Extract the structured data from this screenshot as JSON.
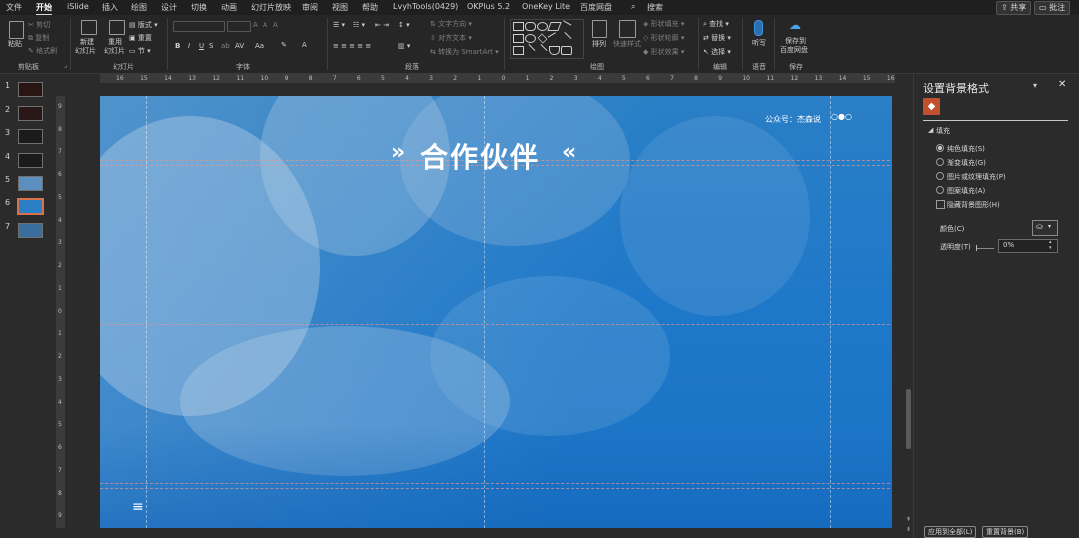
{
  "ribbon_tabs": [
    "文件",
    "开始",
    "iSlide",
    "插入",
    "绘图",
    "设计",
    "切换",
    "动画",
    "幻灯片放映",
    "审阅",
    "视图",
    "帮助",
    "LvyhTools(0429)",
    "OKPlus 5.2",
    "OneKey Lite",
    "百度网盘"
  ],
  "active_tab": "开始",
  "search_label": "搜索",
  "share_label": "共享",
  "comment_label": "批注",
  "clipboard": {
    "paste": "粘贴",
    "cut": "剪切",
    "copy": "复制",
    "format_painter": "格式刷",
    "group": "剪贴板"
  },
  "slides_group": {
    "new_slide_1": "新建",
    "new_slide_2": "幻灯片",
    "reuse_1": "重用",
    "reuse_2": "幻灯片",
    "layout": "版式",
    "reset": "重置",
    "section": "节",
    "group": "幻灯片"
  },
  "font_group": {
    "group": "字体",
    "bold": "B",
    "italic": "I",
    "underline": "U",
    "strike": "S",
    "spacing": "AV",
    "case": "Aa",
    "grow": "A",
    "shrink": "A",
    "clear": "A"
  },
  "paragraph_group": {
    "text_direction": "文字方向",
    "align_text": "对齐文本",
    "smartart": "转换为 SmartArt",
    "group": "段落"
  },
  "drawing_group": {
    "arrange": "排列",
    "quick_styles": "快速样式",
    "fill": "形状填充",
    "outline": "形状轮廓",
    "effects": "形状效果",
    "group": "绘图"
  },
  "editing_group": {
    "find": "查找",
    "replace": "替换",
    "select": "选择",
    "group": "编辑"
  },
  "voice_group": {
    "dictate": "听写",
    "group": "语音"
  },
  "save_group": {
    "save_1": "保存到",
    "save_2": "百度网盘",
    "group": "保存"
  },
  "thumbnails": [
    {
      "num": "1"
    },
    {
      "num": "2"
    },
    {
      "num": "3"
    },
    {
      "num": "4"
    },
    {
      "num": "5"
    },
    {
      "num": "6",
      "active": true
    },
    {
      "num": "7"
    }
  ],
  "ruler_h": [
    "16",
    "15",
    "14",
    "13",
    "12",
    "11",
    "10",
    "9",
    "8",
    "7",
    "6",
    "5",
    "4",
    "3",
    "2",
    "1",
    "0",
    "1",
    "2",
    "3",
    "4",
    "5",
    "6",
    "7",
    "8",
    "9",
    "10",
    "11",
    "12",
    "13",
    "14",
    "15",
    "16"
  ],
  "ruler_v": [
    "9",
    "8",
    "7",
    "6",
    "5",
    "4",
    "3",
    "2",
    "1",
    "0",
    "1",
    "2",
    "3",
    "4",
    "5",
    "6",
    "7",
    "8",
    "9"
  ],
  "slide": {
    "account": "公众号：杰森说",
    "title": "合作伙伴",
    "left_mark": "»",
    "right_mark": "«",
    "menu_glyph": "≡",
    "dots": [
      "○",
      "●",
      "○"
    ]
  },
  "pane": {
    "title": "设置背景格式",
    "section": "填充",
    "options": [
      {
        "label": "纯色填充(S)",
        "selected": true
      },
      {
        "label": "渐变填充(G)",
        "selected": false
      },
      {
        "label": "图片或纹理填充(P)",
        "selected": false
      },
      {
        "label": "图案填充(A)",
        "selected": false
      }
    ],
    "hide_bg": "隐藏背景图形(H)",
    "color_label": "颜色(C)",
    "transparency_label": "透明度(T)",
    "transparency_value": "0%",
    "apply_all": "应用到全部(L)",
    "reset_bg": "重置背景(B)"
  },
  "colors": {
    "accent": "#d8724a",
    "slide_blue": "#1e78c9"
  }
}
